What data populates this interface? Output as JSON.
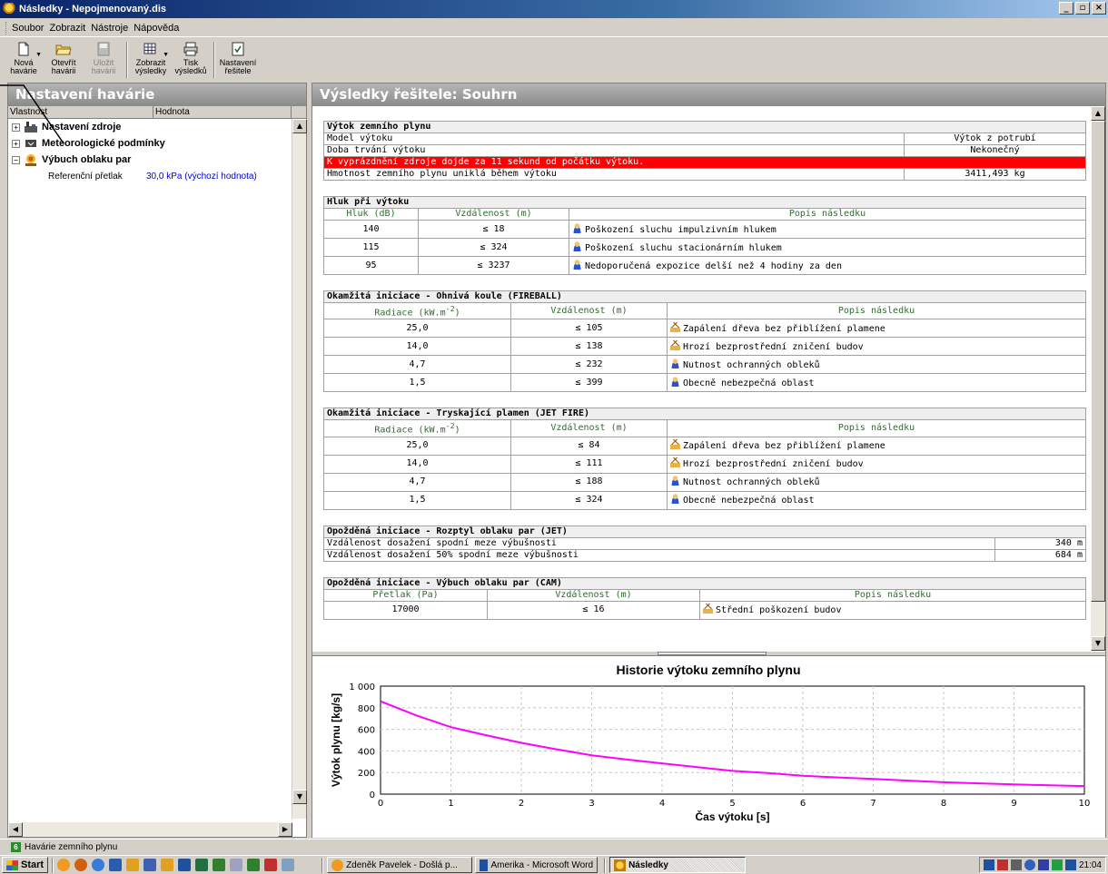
{
  "window": {
    "title": "Následky - Nepojmenovaný.dis",
    "controls": [
      "_",
      "▫",
      "×"
    ]
  },
  "menu": [
    "Soubor",
    "Zobrazit",
    "Nástroje",
    "Nápověda"
  ],
  "toolbar": [
    {
      "line1": "Nová",
      "line2": "havárie",
      "icon": "new-document-icon",
      "dropdown": true,
      "disabled": false
    },
    {
      "line1": "Otevřít",
      "line2": "havárii",
      "icon": "open-folder-icon",
      "disabled": false
    },
    {
      "line1": "Uložit",
      "line2": "havárii",
      "icon": "save-disk-icon",
      "disabled": true
    },
    {
      "line1": "Zobrazit",
      "line2": "výsledky",
      "icon": "grid-view-icon",
      "dropdown": true,
      "disabled": false
    },
    {
      "line1": "Tisk",
      "line2": "výsledků",
      "icon": "printer-icon",
      "disabled": false
    },
    {
      "line1": "Nastavení",
      "line2": "řešitele",
      "icon": "solver-settings-icon",
      "disabled": false
    }
  ],
  "left": {
    "header": "Nastavení havárie",
    "col_property": "Vlastnost",
    "col_value": "Hodnota",
    "tree": [
      {
        "label": "Nastavení zdroje",
        "expander": "+"
      },
      {
        "label": "Meteorologické podmínky",
        "expander": "+"
      },
      {
        "label": "Výbuch oblaku par",
        "expander": "−"
      }
    ],
    "leaf": {
      "label": "Referenční přetlak",
      "value": "30,0 kPa (výchozí hodnota)"
    }
  },
  "right": {
    "header": "Výsledky řešitele: Souhrn",
    "leak": {
      "title": "Výtok zemního plynu",
      "rows": [
        {
          "label": "Model výtoku",
          "value": "Výtok z potrubí"
        },
        {
          "label": "Doba trvání výtoku",
          "value": "Nekonečný"
        }
      ],
      "alert": "K vyprázdnění zdroje dojde za 11 sekund od počátku výtoku.",
      "mass": {
        "label": "Hmotnost zemního plynu uniklá během výtoku",
        "value": "3411,493 kg"
      }
    },
    "noise": {
      "title": "Hluk při výtoku",
      "headers": [
        "Hluk (dB)",
        "Vzdálenost (m)",
        "Popis následku"
      ],
      "rows": [
        {
          "a": "140",
          "b": "≤ 18",
          "desc": "Poškození sluchu impulzivním hlukem",
          "icon": "person"
        },
        {
          "a": "115",
          "b": "≤ 324",
          "desc": "Poškození sluchu stacionárním hlukem",
          "icon": "person"
        },
        {
          "a": "95",
          "b": "≤ 3237",
          "desc": "Nedoporučená expozice delší než 4 hodiny za den",
          "icon": "person"
        }
      ]
    },
    "fireball": {
      "title": "Okamžitá iniciace - Ohnivá koule (FIREBALL)",
      "headers": [
        "Radiace (kW.m",
        "-2",
        ")",
        "Vzdálenost (m)",
        "Popis následku"
      ],
      "rows": [
        {
          "a": "25,0",
          "b": "≤ 105",
          "desc": "Zapálení dřeva bez přiblížení plamene",
          "icon": "house"
        },
        {
          "a": "14,0",
          "b": "≤ 138",
          "desc": "Hrozí bezprostřední zničení budov",
          "icon": "house"
        },
        {
          "a": "4,7",
          "b": "≤ 232",
          "desc": "Nutnost ochranných obleků",
          "icon": "person"
        },
        {
          "a": "1,5",
          "b": "≤ 399",
          "desc": "Obecně nebezpečná oblast",
          "icon": "person"
        }
      ]
    },
    "jetfire": {
      "title": "Okamžitá iniciace - Tryskající plamen (JET FIRE)",
      "headers": [
        "Radiace (kW.m",
        "-2",
        ")",
        "Vzdálenost (m)",
        "Popis následku"
      ],
      "rows": [
        {
          "a": "25,0",
          "b": "≤ 84",
          "desc": "Zapálení dřeva bez přiblížení plamene",
          "icon": "house"
        },
        {
          "a": "14,0",
          "b": "≤ 111",
          "desc": "Hrozí bezprostřední zničení budov",
          "icon": "house"
        },
        {
          "a": "4,7",
          "b": "≤ 188",
          "desc": "Nutnost ochranných obleků",
          "icon": "person"
        },
        {
          "a": "1,5",
          "b": "≤ 324",
          "desc": "Obecně nebezpečná oblast",
          "icon": "person"
        }
      ]
    },
    "dispersion": {
      "title": "Opožděná iniciace - Rozptyl oblaku par (JET)",
      "rows": [
        {
          "label": "Vzdálenost dosažení spodní meze výbušnosti",
          "value": "340 m"
        },
        {
          "label": "Vzdálenost dosažení 50% spodní meze výbušnosti",
          "value": "684 m"
        }
      ]
    },
    "cam": {
      "title": "Opožděná iniciace - Výbuch oblaku par (CAM)",
      "headers": [
        "Přetlak (Pa)",
        "Vzdálenost (m)",
        "Popis následku"
      ],
      "rows": [
        {
          "a": "17000",
          "b": "≤ 16",
          "desc": "Střední poškození budov",
          "icon": "house"
        }
      ]
    }
  },
  "chart_data": {
    "type": "line",
    "title": "Historie výtoku zemního plynu",
    "xlabel": "Čas výtoku [s]",
    "ylabel": "Výtok plynu [kg/s]",
    "xlim": [
      0,
      10
    ],
    "ylim": [
      0,
      1000
    ],
    "xticks": [
      "0",
      "1",
      "2",
      "3",
      "4",
      "5",
      "6",
      "7",
      "8",
      "9",
      "10"
    ],
    "yticks": [
      "0",
      "200",
      "400",
      "600",
      "800",
      "1 000"
    ],
    "grid": true,
    "line_color": "#ff00ff",
    "series": [
      {
        "x": [
          0,
          0.5,
          1,
          1.5,
          2,
          2.5,
          3,
          3.5,
          4,
          4.5,
          5,
          5.5,
          6,
          6.5,
          7,
          7.5,
          8,
          8.5,
          9,
          9.5,
          10
        ],
        "y": [
          860,
          730,
          620,
          545,
          475,
          415,
          360,
          320,
          285,
          250,
          215,
          195,
          170,
          155,
          140,
          125,
          110,
          100,
          90,
          82,
          75
        ]
      }
    ]
  },
  "status": {
    "icon_text": "6",
    "text": "Havárie zemního plynu"
  },
  "taskbar": {
    "start": "Start",
    "tasks": [
      {
        "label": "Zdeněk Pavelek - Došlá p...",
        "icon": "mail-icon",
        "active": false
      },
      {
        "label": "Amerika - Microsoft Word",
        "icon": "word-icon",
        "active": false
      },
      {
        "label": "Následky",
        "icon": "app-icon",
        "active": true
      }
    ],
    "clock": "21:04"
  }
}
